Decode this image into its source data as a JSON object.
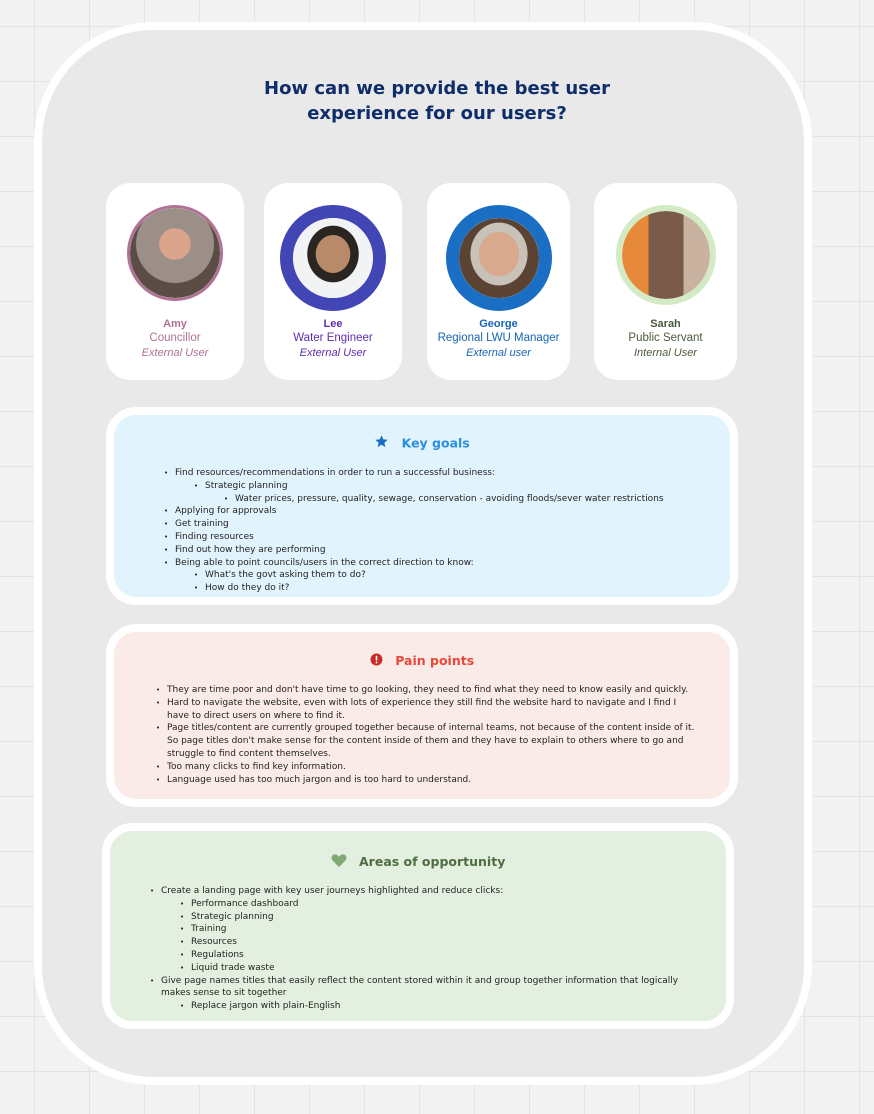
{
  "title_line1": "How can we provide the best user",
  "title_line2": "experience for our users?",
  "personas": [
    {
      "name": "Amy",
      "role": "Councillor",
      "type": "External User",
      "color": "#b07295",
      "ring": "#b07295"
    },
    {
      "name": "Lee",
      "role": "Water Engineer",
      "type": "External User",
      "color": "#5b2fb2",
      "ring": "#4146b4"
    },
    {
      "name": "George",
      "role": "Regional LWU Manager",
      "type": "External user",
      "color": "#1565b4",
      "ring": "#1a6fc4"
    },
    {
      "name": "Sarah",
      "role": "Public Servant",
      "type": "Internal User",
      "color": "#4a5b3c",
      "ring": "#d3ebc4"
    }
  ],
  "key_goals": {
    "icon": "star-icon",
    "heading": "Key goals",
    "color": "#2a8fdc",
    "bg": "#e1f3fd",
    "items": [
      {
        "text": "Find resources/recommendations in order to run a successful business:"
      },
      {
        "text": "Strategic planning",
        "level": 2
      },
      {
        "text": "Water prices, pressure, quality, sewage, conservation - avoiding floods/sever water restrictions",
        "level": 3
      },
      {
        "text": "Applying for approvals"
      },
      {
        "text": "Get training"
      },
      {
        "text": "Finding resources"
      },
      {
        "text": "Find out how they are performing"
      },
      {
        "text": "Being able to point councils/users in the correct direction to know:"
      },
      {
        "text": "What's the govt asking them to do?",
        "level": 2
      },
      {
        "text": "How do they do it?",
        "level": 2
      }
    ]
  },
  "pain_points": {
    "icon": "exclamation-circle-icon",
    "heading": "Pain points",
    "color": "#e8483a",
    "bg": "#fbebe8",
    "items": [
      "They are time poor and don't have time to go looking, they need to find what they need to know easily and quickly.",
      "Hard to navigate the website, even with lots of experience they still find the website hard to navigate and I find I have to direct users on where to find it.",
      "Page titles/content are currently grouped together because of internal teams, not because of the content inside of it. So page titles don't make sense for the content inside of them and they have to explain to others where to go and struggle to find content themselves.",
      "Too many clicks to find key information.",
      "Language used has too much jargon and is too hard to understand."
    ]
  },
  "opportunity": {
    "icon": "heart-icon",
    "heading": "Areas of opportunity",
    "color": "#4f6d41",
    "icon_color": "#7fa875",
    "bg": "#e4f0df",
    "items": [
      {
        "text": "Create a landing page with key user journeys highlighted and reduce clicks:"
      },
      {
        "text": "Performance dashboard",
        "level": 2
      },
      {
        "text": "Strategic planning",
        "level": 2
      },
      {
        "text": "Training",
        "level": 2
      },
      {
        "text": "Resources",
        "level": 2
      },
      {
        "text": "Regulations",
        "level": 2
      },
      {
        "text": "Liquid trade waste",
        "level": 2
      },
      {
        "text": "Give page names titles that easily reflect the content stored within it and group together information that logically makes sense to sit together"
      },
      {
        "text": "Replace jargon with plain-English",
        "level": 2
      }
    ]
  }
}
